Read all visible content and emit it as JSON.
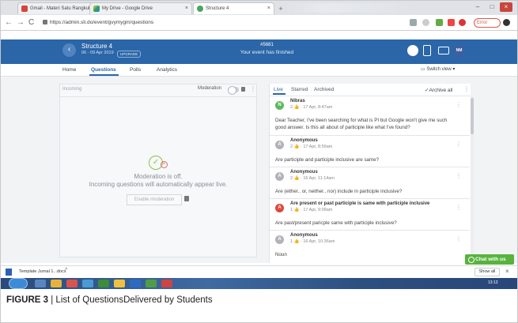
{
  "browser": {
    "tabs": [
      {
        "label": "Gmail - Materi Satu Rangkul 2018",
        "active": false
      },
      {
        "label": "My Drive - Google Drive",
        "active": false
      },
      {
        "label": "Structure 4",
        "active": true
      }
    ],
    "url": "https://admin.sli.do/event/gvymygm/questions",
    "error_label": "Error"
  },
  "header": {
    "event_title": "Structure 4",
    "event_dates": "06 - 09 Apr 2019",
    "upgrade_label": "UPGRADE",
    "event_code": "#5681",
    "event_status": "Your event has finished",
    "avatar_initials": "NM"
  },
  "subnav": {
    "items": [
      "Home",
      "Questions",
      "Polls",
      "Analytics"
    ],
    "switch_view": "Switch view"
  },
  "incoming_panel": {
    "title": "Incoming",
    "moderation_label": "Moderation",
    "moderation_status": "Moderation is off.",
    "empty_message": "Incoming questions will automatically appear live.",
    "enable_button": "Enable moderation"
  },
  "live_panel": {
    "tabs": [
      "Live",
      "Starred",
      "Archived"
    ],
    "archive_all": "Archive all",
    "questions": [
      {
        "author": "Nibras",
        "initial": "N",
        "avatar_color": "#5cb85c",
        "likes": "2",
        "time": "17 Apr, 8:47am",
        "text": "Dear Teacher, I've been searching for what is PI but Google won't give me such good answer. Is this all about of participle like what I've found?"
      },
      {
        "author": "Anonymous",
        "initial": "A",
        "avatar_color": "#b0b4b9",
        "likes": "2",
        "time": "17 Apr, 8:59am",
        "text": "Are participle and participle inclusive are same?"
      },
      {
        "author": "Anonymous",
        "initial": "A",
        "avatar_color": "#b0b4b9",
        "likes": "2",
        "time": "16 Apr, 11:14am",
        "text": "Are (either.. or, neither.. nor) include in participle inclusive?"
      },
      {
        "author": "Are present or past participle is same with participle inclusive",
        "initial": "A",
        "avatar_color": "#e0473d",
        "likes": "1",
        "time": "17 Apr, 9:09am",
        "text": "Are past/present paricple same with participle inclusive?"
      },
      {
        "author": "Anonymous",
        "initial": "A",
        "avatar_color": "#b0b4b9",
        "likes": "1",
        "time": "16 Apr, 10:36am",
        "text": "Noun"
      }
    ],
    "chat_button": "Chat with us"
  },
  "downloads": {
    "file_name": "Template Jurnal 1...docx",
    "show_all": "Show all"
  },
  "taskbar": {
    "clock": "13:13"
  },
  "caption": {
    "label": "FIGURE 3",
    "text": " | List of QuestionsDelivered by Students"
  }
}
